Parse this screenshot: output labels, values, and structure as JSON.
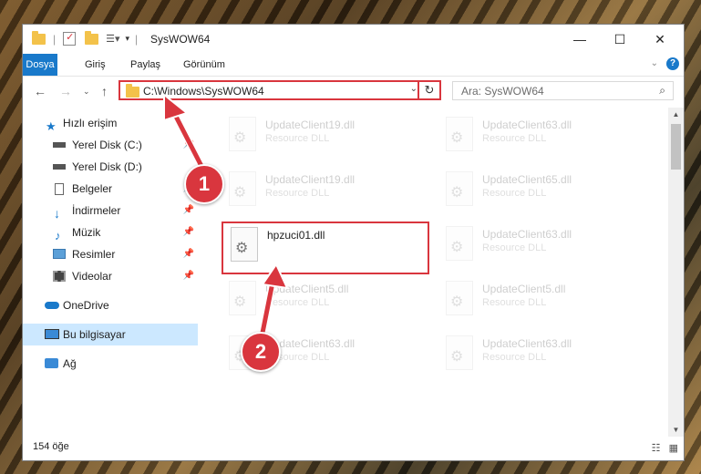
{
  "window": {
    "title": "SysWOW64"
  },
  "window_controls": {
    "minimize": "—",
    "maximize": "☐",
    "close": "✕"
  },
  "ribbon": {
    "tabs": [
      "Dosya",
      "Giriş",
      "Paylaş",
      "Görünüm"
    ],
    "help": "?"
  },
  "address_bar": {
    "path": "C:\\Windows\\SysWOW64",
    "refresh_glyph": "↻"
  },
  "search": {
    "placeholder": "Ara: SysWOW64"
  },
  "sidebar": {
    "items": [
      {
        "label": "Hızlı erişim",
        "icon": "star-icon"
      },
      {
        "label": "Yerel Disk (C:)",
        "icon": "drive-icon"
      },
      {
        "label": "Yerel Disk (D:)",
        "icon": "drive-icon"
      },
      {
        "label": "Belgeler",
        "icon": "document-icon"
      },
      {
        "label": "İndirmeler",
        "icon": "download-icon"
      },
      {
        "label": "Müzik",
        "icon": "music-icon"
      },
      {
        "label": "Resimler",
        "icon": "picture-icon"
      },
      {
        "label": "Videolar",
        "icon": "video-icon"
      },
      {
        "label": "OneDrive",
        "icon": "cloud-icon"
      },
      {
        "label": "Bu bilgisayar",
        "icon": "computer-icon"
      },
      {
        "label": "Ağ",
        "icon": "network-icon"
      }
    ]
  },
  "files": [
    {
      "name": "UpdateClient19.dll",
      "type": "Resource DLL"
    },
    {
      "name": "UpdateClient63.dll",
      "type": "Resource DLL"
    },
    {
      "name": "UpdateClient19.dll",
      "type": "Resource DLL"
    },
    {
      "name": "UpdateClient65.dll",
      "type": "Resource DLL"
    },
    {
      "name": "hpzuci01.dll",
      "type": ""
    },
    {
      "name": "UpdateClient63.dll",
      "type": "Resource DLL"
    },
    {
      "name": "UpdateClient5.dll",
      "type": "Resource DLL"
    },
    {
      "name": "UpdateClient5.dll",
      "type": "Resource DLL"
    },
    {
      "name": "UpdateClient63.dll",
      "type": "Resource DLL"
    },
    {
      "name": "UpdateClient63.dll",
      "type": "Resource DLL"
    }
  ],
  "status": {
    "item_count": "154 öğe"
  },
  "callouts": [
    "1",
    "2"
  ],
  "colors": {
    "accent": "#1979ca",
    "highlight": "#d9363e",
    "selected": "#cce8ff"
  }
}
